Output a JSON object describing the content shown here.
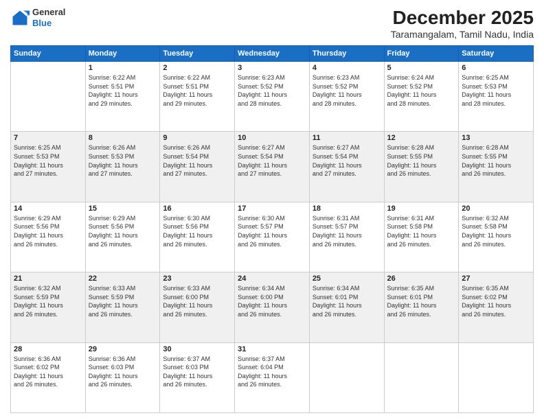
{
  "header": {
    "logo_line1": "General",
    "logo_line2": "Blue",
    "month_title": "December 2025",
    "location": "Taramangalam, Tamil Nadu, India"
  },
  "days_of_week": [
    "Sunday",
    "Monday",
    "Tuesday",
    "Wednesday",
    "Thursday",
    "Friday",
    "Saturday"
  ],
  "weeks": [
    [
      {
        "day": "",
        "info": ""
      },
      {
        "day": "1",
        "info": "Sunrise: 6:22 AM\nSunset: 5:51 PM\nDaylight: 11 hours\nand 29 minutes."
      },
      {
        "day": "2",
        "info": "Sunrise: 6:22 AM\nSunset: 5:51 PM\nDaylight: 11 hours\nand 29 minutes."
      },
      {
        "day": "3",
        "info": "Sunrise: 6:23 AM\nSunset: 5:52 PM\nDaylight: 11 hours\nand 28 minutes."
      },
      {
        "day": "4",
        "info": "Sunrise: 6:23 AM\nSunset: 5:52 PM\nDaylight: 11 hours\nand 28 minutes."
      },
      {
        "day": "5",
        "info": "Sunrise: 6:24 AM\nSunset: 5:52 PM\nDaylight: 11 hours\nand 28 minutes."
      },
      {
        "day": "6",
        "info": "Sunrise: 6:25 AM\nSunset: 5:53 PM\nDaylight: 11 hours\nand 28 minutes."
      }
    ],
    [
      {
        "day": "7",
        "info": "Sunrise: 6:25 AM\nSunset: 5:53 PM\nDaylight: 11 hours\nand 27 minutes."
      },
      {
        "day": "8",
        "info": "Sunrise: 6:26 AM\nSunset: 5:53 PM\nDaylight: 11 hours\nand 27 minutes."
      },
      {
        "day": "9",
        "info": "Sunrise: 6:26 AM\nSunset: 5:54 PM\nDaylight: 11 hours\nand 27 minutes."
      },
      {
        "day": "10",
        "info": "Sunrise: 6:27 AM\nSunset: 5:54 PM\nDaylight: 11 hours\nand 27 minutes."
      },
      {
        "day": "11",
        "info": "Sunrise: 6:27 AM\nSunset: 5:54 PM\nDaylight: 11 hours\nand 27 minutes."
      },
      {
        "day": "12",
        "info": "Sunrise: 6:28 AM\nSunset: 5:55 PM\nDaylight: 11 hours\nand 26 minutes."
      },
      {
        "day": "13",
        "info": "Sunrise: 6:28 AM\nSunset: 5:55 PM\nDaylight: 11 hours\nand 26 minutes."
      }
    ],
    [
      {
        "day": "14",
        "info": "Sunrise: 6:29 AM\nSunset: 5:56 PM\nDaylight: 11 hours\nand 26 minutes."
      },
      {
        "day": "15",
        "info": "Sunrise: 6:29 AM\nSunset: 5:56 PM\nDaylight: 11 hours\nand 26 minutes."
      },
      {
        "day": "16",
        "info": "Sunrise: 6:30 AM\nSunset: 5:56 PM\nDaylight: 11 hours\nand 26 minutes."
      },
      {
        "day": "17",
        "info": "Sunrise: 6:30 AM\nSunset: 5:57 PM\nDaylight: 11 hours\nand 26 minutes."
      },
      {
        "day": "18",
        "info": "Sunrise: 6:31 AM\nSunset: 5:57 PM\nDaylight: 11 hours\nand 26 minutes."
      },
      {
        "day": "19",
        "info": "Sunrise: 6:31 AM\nSunset: 5:58 PM\nDaylight: 11 hours\nand 26 minutes."
      },
      {
        "day": "20",
        "info": "Sunrise: 6:32 AM\nSunset: 5:58 PM\nDaylight: 11 hours\nand 26 minutes."
      }
    ],
    [
      {
        "day": "21",
        "info": "Sunrise: 6:32 AM\nSunset: 5:59 PM\nDaylight: 11 hours\nand 26 minutes."
      },
      {
        "day": "22",
        "info": "Sunrise: 6:33 AM\nSunset: 5:59 PM\nDaylight: 11 hours\nand 26 minutes."
      },
      {
        "day": "23",
        "info": "Sunrise: 6:33 AM\nSunset: 6:00 PM\nDaylight: 11 hours\nand 26 minutes."
      },
      {
        "day": "24",
        "info": "Sunrise: 6:34 AM\nSunset: 6:00 PM\nDaylight: 11 hours\nand 26 minutes."
      },
      {
        "day": "25",
        "info": "Sunrise: 6:34 AM\nSunset: 6:01 PM\nDaylight: 11 hours\nand 26 minutes."
      },
      {
        "day": "26",
        "info": "Sunrise: 6:35 AM\nSunset: 6:01 PM\nDaylight: 11 hours\nand 26 minutes."
      },
      {
        "day": "27",
        "info": "Sunrise: 6:35 AM\nSunset: 6:02 PM\nDaylight: 11 hours\nand 26 minutes."
      }
    ],
    [
      {
        "day": "28",
        "info": "Sunrise: 6:36 AM\nSunset: 6:02 PM\nDaylight: 11 hours\nand 26 minutes."
      },
      {
        "day": "29",
        "info": "Sunrise: 6:36 AM\nSunset: 6:03 PM\nDaylight: 11 hours\nand 26 minutes."
      },
      {
        "day": "30",
        "info": "Sunrise: 6:37 AM\nSunset: 6:03 PM\nDaylight: 11 hours\nand 26 minutes."
      },
      {
        "day": "31",
        "info": "Sunrise: 6:37 AM\nSunset: 6:04 PM\nDaylight: 11 hours\nand 26 minutes."
      },
      {
        "day": "",
        "info": ""
      },
      {
        "day": "",
        "info": ""
      },
      {
        "day": "",
        "info": ""
      }
    ]
  ]
}
